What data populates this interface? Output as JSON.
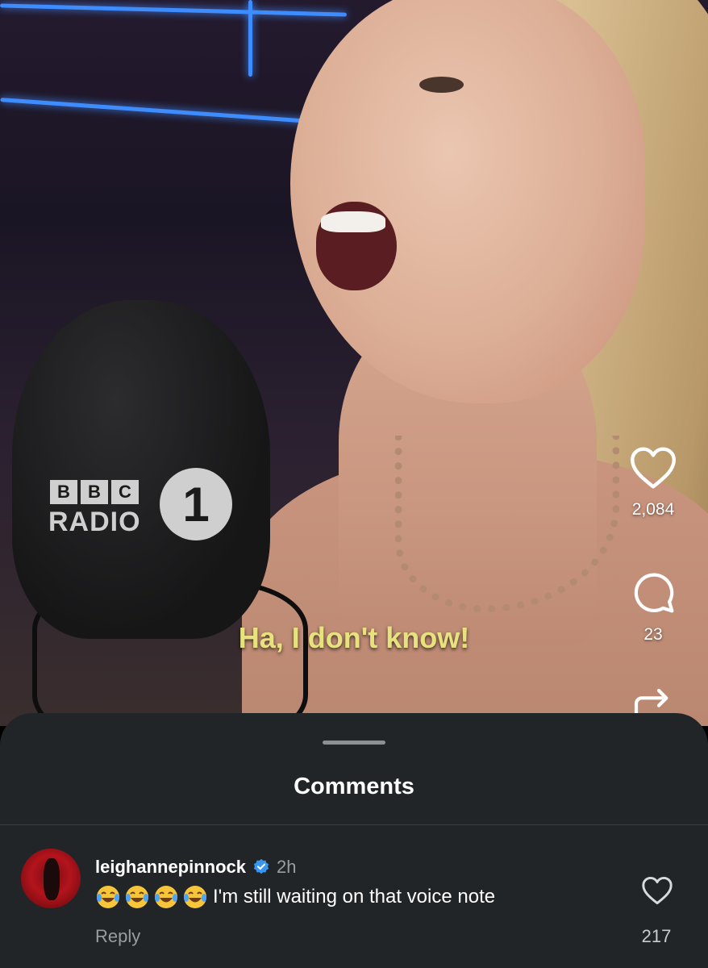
{
  "video": {
    "subtitle": "Ha, I don't know!",
    "mic_logo": {
      "letters": [
        "B",
        "B",
        "C"
      ],
      "word": "RADIO",
      "number": "1"
    }
  },
  "actions": {
    "like": {
      "icon": "heart-icon",
      "count": "2,084"
    },
    "comment": {
      "icon": "comment-icon",
      "count": "23"
    },
    "share": {
      "icon": "share-icon"
    }
  },
  "sheet": {
    "title": "Comments"
  },
  "comment": {
    "username": "leighannepinnock",
    "verified": true,
    "time": "2h",
    "emojis": [
      "😂",
      "😂",
      "😂",
      "😂"
    ],
    "text": "I'm still waiting on that voice note",
    "reply_label": "Reply",
    "like_count": "217"
  },
  "colors": {
    "subtitle": "#e8e27e",
    "sheet_bg": "#222527",
    "verified": "#3797f0",
    "muted_text": "#9a9da0"
  }
}
